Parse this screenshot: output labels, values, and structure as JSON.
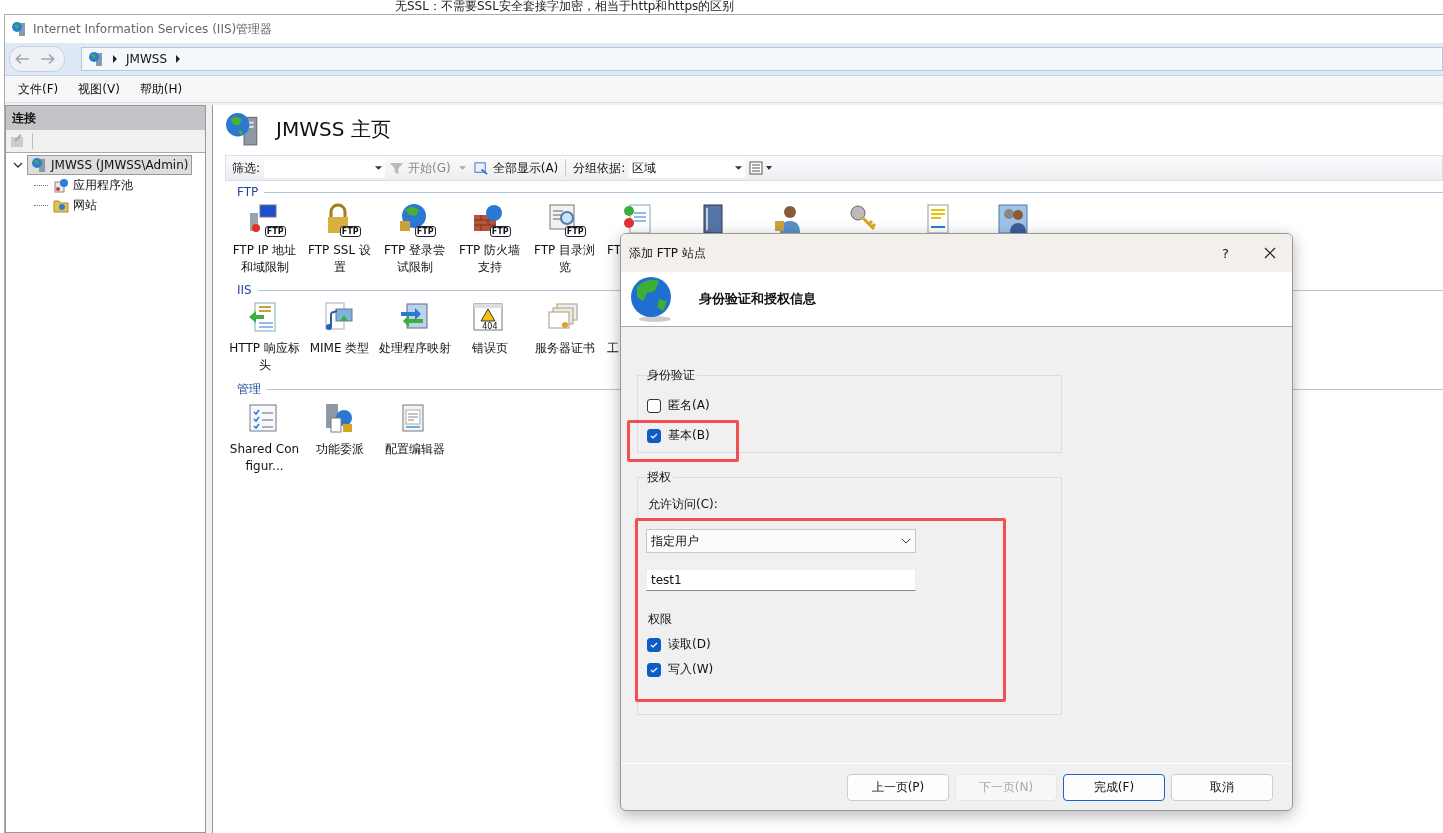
{
  "page_note": "无SSL：不需要SSL安全套接字加密，相当于http和https的区别",
  "window": {
    "title": "Internet Information Services (IIS)管理器"
  },
  "address_bar": {
    "path": [
      "JMWSS"
    ]
  },
  "menu": [
    {
      "label": "文件(F)"
    },
    {
      "label": "视图(V)"
    },
    {
      "label": "帮助(H)"
    }
  ],
  "connections": {
    "title": "连接",
    "tree": [
      {
        "label": "JMWSS (JMWSS\\Admin)",
        "kind": "server",
        "expanded": true,
        "selected": true,
        "children": [
          {
            "label": "应用程序池",
            "kind": "pool",
            "selected": false
          },
          {
            "label": "网站",
            "kind": "sites",
            "selected": false
          }
        ]
      }
    ]
  },
  "home": {
    "title": "JMWSS 主页",
    "toolbar": {
      "filter_label": "筛选:",
      "start": "开始(G)",
      "show_all": "全部显示(A)",
      "group_by_label": "分组依据:",
      "group_by_value": "区域"
    },
    "groups": [
      {
        "name": "FTP",
        "items": [
          {
            "label": "FTP IP 地址和域限制",
            "kind": "computer",
            "badge": "FTP"
          },
          {
            "label": "FTP SSL 设置",
            "kind": "lock",
            "badge": "FTP"
          },
          {
            "label": "FTP 登录尝试限制",
            "kind": "globe",
            "badge": "FTP"
          },
          {
            "label": "FTP 防火墙支持",
            "kind": "wall",
            "badge": "FTP"
          },
          {
            "label": "FTP 目录浏览",
            "kind": "browse",
            "badge": "FTP"
          },
          {
            "label": "FT",
            "kind": "doccheck",
            "cut_off": true
          },
          {
            "kind": "notebook"
          },
          {
            "kind": "person"
          },
          {
            "kind": "key"
          },
          {
            "kind": "docyellow"
          },
          {
            "kind": "people"
          }
        ]
      },
      {
        "name": "IIS",
        "items": [
          {
            "label": "HTTP 响应标头",
            "kind": "http"
          },
          {
            "label": "MIME 类型",
            "kind": "mime"
          },
          {
            "label": "处理程序映射",
            "kind": "arrows"
          },
          {
            "label": "错误页",
            "kind": "error",
            "badge": "404"
          },
          {
            "label": "服务器证书",
            "kind": "cert"
          },
          {
            "label": "工",
            "cut_off": true
          }
        ]
      },
      {
        "name": "管理",
        "items": [
          {
            "label": "Shared Configur...",
            "kind": "checklist"
          },
          {
            "label": "功能委派",
            "kind": "delegation"
          },
          {
            "label": "配置编辑器",
            "kind": "config"
          }
        ]
      }
    ]
  },
  "dialog": {
    "title": "添加 FTP 站点",
    "help": "?",
    "heading": "身份验证和授权信息",
    "authentication": {
      "title": "身份验证",
      "options": [
        {
          "label": "匿名(A)",
          "checked": false,
          "highlighted": false
        },
        {
          "label": "基本(B)",
          "checked": true,
          "highlighted": true
        }
      ]
    },
    "authorization": {
      "title": "授权",
      "highlighted": true,
      "access_label": "允许访问(C):",
      "access_value": "指定用户",
      "user": "test1",
      "permissions_label": "权限",
      "permissions": [
        {
          "label": "读取(D)",
          "checked": true
        },
        {
          "label": "写入(W)",
          "checked": true
        }
      ]
    },
    "buttons": [
      {
        "label": "上一页(P)",
        "disabled": false,
        "default": false
      },
      {
        "label": "下一页(N)",
        "disabled": true,
        "default": false
      },
      {
        "label": "完成(F)",
        "disabled": false,
        "default": true
      },
      {
        "label": "取消",
        "disabled": false,
        "default": false
      }
    ]
  }
}
